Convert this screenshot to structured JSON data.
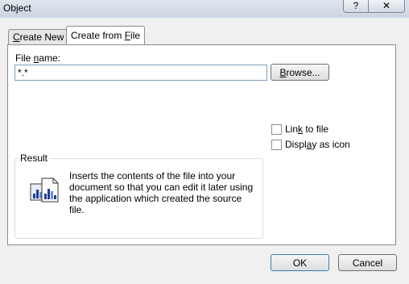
{
  "window": {
    "title": "Object",
    "help_glyph": "?",
    "close_glyph": "✕"
  },
  "tabs": [
    {
      "label_pre": "",
      "label_u": "C",
      "label_post": "reate New"
    },
    {
      "label_pre": "Create from ",
      "label_u": "F",
      "label_post": "ile"
    }
  ],
  "file_name": {
    "label_pre": "File ",
    "label_u": "n",
    "label_post": "ame:",
    "value": "*.*"
  },
  "browse": {
    "label_pre": "",
    "label_u": "B",
    "label_post": "rowse..."
  },
  "link_to_file": {
    "label_pre": "Lin",
    "label_u": "k",
    "label_post": " to file",
    "checked": false
  },
  "display_as_icon": {
    "label_pre": "Displ",
    "label_u": "a",
    "label_post": "y as icon",
    "checked": false
  },
  "result": {
    "legend": "Result",
    "text": "Inserts the contents of the file into your document so that you can edit it later using the application which created the source file.",
    "icon": "insert-file-icon"
  },
  "buttons": {
    "ok": "OK",
    "cancel": "Cancel"
  }
}
